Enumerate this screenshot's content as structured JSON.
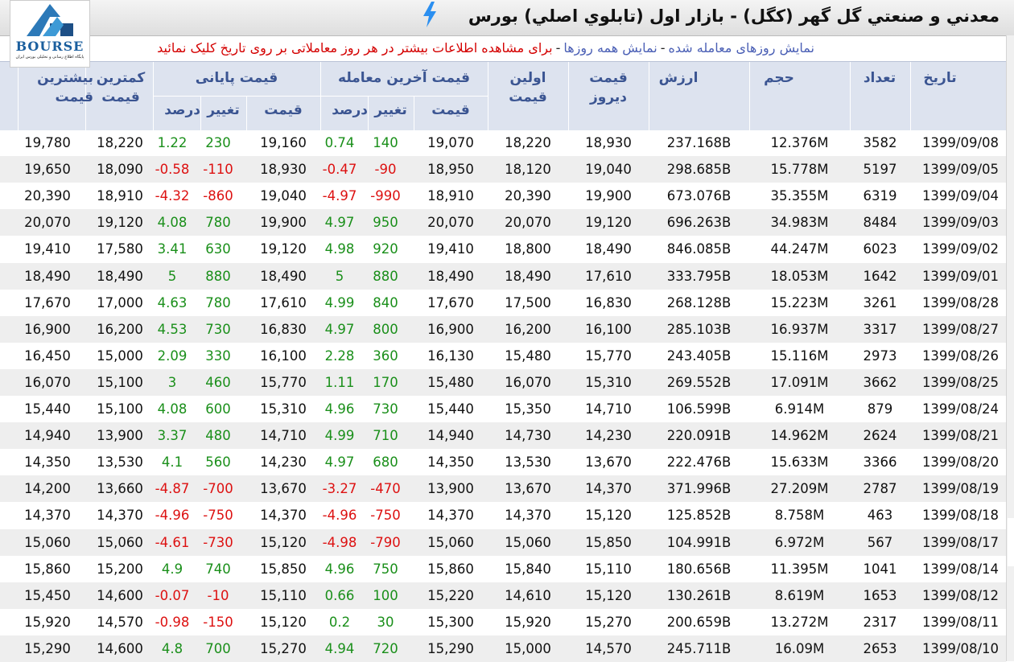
{
  "header": {
    "title": "معدني و صنعتي گل گهر (كگل) - بازار اول (تابلوي اصلي) بورس",
    "logo_text": "BOURSE",
    "logo_subtitle": "پایگاه اطلاع رسانی و تحلیلی بورس ایران"
  },
  "links": {
    "traded_days": "نمایش روزهای معامله شده",
    "all_days": "نمایش همه روزها",
    "note": "برای مشاهده اطلاعات بیشتر در هر روز معاملاتی بر روی تاریخ کلیک نمائید",
    "separator": "-"
  },
  "columns": {
    "date": "تاریخ",
    "count": "تعداد",
    "volume": "حجم",
    "value": "ارزش",
    "prev_price": "قیمت دیروز",
    "first_price": "اولین قیمت",
    "last_trade": "قیمت آخرین معامله",
    "closing": "قیمت پایانی",
    "min_price": "کمترین قیمت",
    "max_price": "بیشترین قیمت",
    "sub_price": "قیمت",
    "sub_change": "تغییر",
    "sub_percent": "درصد"
  },
  "rows": [
    {
      "date": "1399/09/08",
      "count": "3582",
      "volume": "12.376M",
      "value": "237.168B",
      "prev": "18,930",
      "first": "18,220",
      "last_price": "19,070",
      "last_change": "140",
      "last_pct": "0.74",
      "close_price": "19,160",
      "close_change": "230",
      "close_pct": "1.22",
      "min": "18,220",
      "max": "19,780"
    },
    {
      "date": "1399/09/05",
      "count": "5197",
      "volume": "15.778M",
      "value": "298.685B",
      "prev": "19,040",
      "first": "18,120",
      "last_price": "18,950",
      "last_change": "-90",
      "last_pct": "-0.47",
      "close_price": "18,930",
      "close_change": "-110",
      "close_pct": "-0.58",
      "min": "18,090",
      "max": "19,650"
    },
    {
      "date": "1399/09/04",
      "count": "6319",
      "volume": "35.355M",
      "value": "673.076B",
      "prev": "19,900",
      "first": "20,390",
      "last_price": "18,910",
      "last_change": "-990",
      "last_pct": "-4.97",
      "close_price": "19,040",
      "close_change": "-860",
      "close_pct": "-4.32",
      "min": "18,910",
      "max": "20,390"
    },
    {
      "date": "1399/09/03",
      "count": "8484",
      "volume": "34.983M",
      "value": "696.263B",
      "prev": "19,120",
      "first": "20,070",
      "last_price": "20,070",
      "last_change": "950",
      "last_pct": "4.97",
      "close_price": "19,900",
      "close_change": "780",
      "close_pct": "4.08",
      "min": "19,120",
      "max": "20,070"
    },
    {
      "date": "1399/09/02",
      "count": "6023",
      "volume": "44.247M",
      "value": "846.085B",
      "prev": "18,490",
      "first": "18,800",
      "last_price": "19,410",
      "last_change": "920",
      "last_pct": "4.98",
      "close_price": "19,120",
      "close_change": "630",
      "close_pct": "3.41",
      "min": "17,580",
      "max": "19,410"
    },
    {
      "date": "1399/09/01",
      "count": "1642",
      "volume": "18.053M",
      "value": "333.795B",
      "prev": "17,610",
      "first": "18,490",
      "last_price": "18,490",
      "last_change": "880",
      "last_pct": "5",
      "close_price": "18,490",
      "close_change": "880",
      "close_pct": "5",
      "min": "18,490",
      "max": "18,490"
    },
    {
      "date": "1399/08/28",
      "count": "3261",
      "volume": "15.223M",
      "value": "268.128B",
      "prev": "16,830",
      "first": "17,500",
      "last_price": "17,670",
      "last_change": "840",
      "last_pct": "4.99",
      "close_price": "17,610",
      "close_change": "780",
      "close_pct": "4.63",
      "min": "17,000",
      "max": "17,670"
    },
    {
      "date": "1399/08/27",
      "count": "3317",
      "volume": "16.937M",
      "value": "285.103B",
      "prev": "16,100",
      "first": "16,200",
      "last_price": "16,900",
      "last_change": "800",
      "last_pct": "4.97",
      "close_price": "16,830",
      "close_change": "730",
      "close_pct": "4.53",
      "min": "16,200",
      "max": "16,900"
    },
    {
      "date": "1399/08/26",
      "count": "2973",
      "volume": "15.116M",
      "value": "243.405B",
      "prev": "15,770",
      "first": "15,480",
      "last_price": "16,130",
      "last_change": "360",
      "last_pct": "2.28",
      "close_price": "16,100",
      "close_change": "330",
      "close_pct": "2.09",
      "min": "15,000",
      "max": "16,450"
    },
    {
      "date": "1399/08/25",
      "count": "3662",
      "volume": "17.091M",
      "value": "269.552B",
      "prev": "15,310",
      "first": "16,070",
      "last_price": "15,480",
      "last_change": "170",
      "last_pct": "1.11",
      "close_price": "15,770",
      "close_change": "460",
      "close_pct": "3",
      "min": "15,100",
      "max": "16,070"
    },
    {
      "date": "1399/08/24",
      "count": "879",
      "volume": "6.914M",
      "value": "106.599B",
      "prev": "14,710",
      "first": "15,350",
      "last_price": "15,440",
      "last_change": "730",
      "last_pct": "4.96",
      "close_price": "15,310",
      "close_change": "600",
      "close_pct": "4.08",
      "min": "15,100",
      "max": "15,440"
    },
    {
      "date": "1399/08/21",
      "count": "2624",
      "volume": "14.962M",
      "value": "220.091B",
      "prev": "14,230",
      "first": "14,730",
      "last_price": "14,940",
      "last_change": "710",
      "last_pct": "4.99",
      "close_price": "14,710",
      "close_change": "480",
      "close_pct": "3.37",
      "min": "13,900",
      "max": "14,940"
    },
    {
      "date": "1399/08/20",
      "count": "3366",
      "volume": "15.633M",
      "value": "222.476B",
      "prev": "13,670",
      "first": "13,530",
      "last_price": "14,350",
      "last_change": "680",
      "last_pct": "4.97",
      "close_price": "14,230",
      "close_change": "560",
      "close_pct": "4.1",
      "min": "13,530",
      "max": "14,350"
    },
    {
      "date": "1399/08/19",
      "count": "2787",
      "volume": "27.209M",
      "value": "371.996B",
      "prev": "14,370",
      "first": "13,670",
      "last_price": "13,900",
      "last_change": "-470",
      "last_pct": "-3.27",
      "close_price": "13,670",
      "close_change": "-700",
      "close_pct": "-4.87",
      "min": "13,660",
      "max": "14,200"
    },
    {
      "date": "1399/08/18",
      "count": "463",
      "volume": "8.758M",
      "value": "125.852B",
      "prev": "15,120",
      "first": "14,370",
      "last_price": "14,370",
      "last_change": "-750",
      "last_pct": "-4.96",
      "close_price": "14,370",
      "close_change": "-750",
      "close_pct": "-4.96",
      "min": "14,370",
      "max": "14,370"
    },
    {
      "date": "1399/08/17",
      "count": "567",
      "volume": "6.972M",
      "value": "104.991B",
      "prev": "15,850",
      "first": "15,060",
      "last_price": "15,060",
      "last_change": "-790",
      "last_pct": "-4.98",
      "close_price": "15,120",
      "close_change": "-730",
      "close_pct": "-4.61",
      "min": "15,060",
      "max": "15,060"
    },
    {
      "date": "1399/08/14",
      "count": "1041",
      "volume": "11.395M",
      "value": "180.656B",
      "prev": "15,110",
      "first": "15,840",
      "last_price": "15,860",
      "last_change": "750",
      "last_pct": "4.96",
      "close_price": "15,850",
      "close_change": "740",
      "close_pct": "4.9",
      "min": "15,200",
      "max": "15,860"
    },
    {
      "date": "1399/08/12",
      "count": "1653",
      "volume": "8.619M",
      "value": "130.261B",
      "prev": "15,120",
      "first": "14,610",
      "last_price": "15,220",
      "last_change": "100",
      "last_pct": "0.66",
      "close_price": "15,110",
      "close_change": "-10",
      "close_pct": "-0.07",
      "min": "14,600",
      "max": "15,450"
    },
    {
      "date": "1399/08/11",
      "count": "2317",
      "volume": "13.272M",
      "value": "200.659B",
      "prev": "15,270",
      "first": "15,920",
      "last_price": "15,300",
      "last_change": "30",
      "last_pct": "0.2",
      "close_price": "15,120",
      "close_change": "-150",
      "close_pct": "-0.98",
      "min": "14,570",
      "max": "15,920"
    },
    {
      "date": "1399/08/10",
      "count": "2653",
      "volume": "16.09M",
      "value": "245.711B",
      "prev": "14,570",
      "first": "15,000",
      "last_price": "15,290",
      "last_change": "720",
      "last_pct": "4.94",
      "close_price": "15,270",
      "close_change": "700",
      "close_pct": "4.8",
      "min": "14,600",
      "max": "15,290"
    }
  ],
  "colors": {
    "header_bg": "#dde3ef",
    "header_text": "#3b5592",
    "positive": "#1a8f1a",
    "negative": "#dd1111",
    "link": "#4a5fb5",
    "row_alt": "#eeeeee"
  },
  "icons": {
    "title_icon": "lightning-bolt-icon",
    "logo": "bourse-logo"
  }
}
